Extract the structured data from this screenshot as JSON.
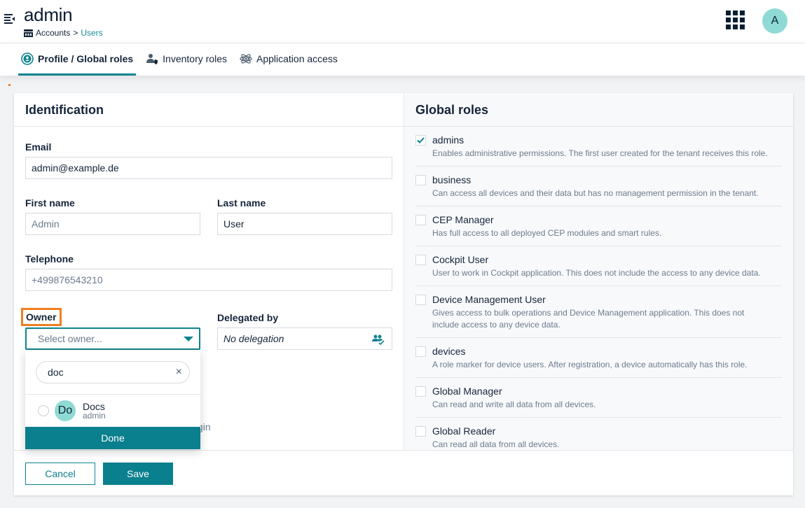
{
  "header": {
    "title": "admin",
    "breadcrumb": {
      "root": "Accounts",
      "separator": ">",
      "current": "Users"
    },
    "avatar_initial": "A",
    "icons": {
      "nav_toggle": "menu-collapse-icon",
      "breadcrumb": "accounts-icon",
      "apps": "app-grid-icon"
    }
  },
  "tabs": [
    {
      "label": "Profile / Global roles",
      "icon": "user-circle-icon",
      "active": true
    },
    {
      "label": "Inventory roles",
      "icon": "user-shield-icon",
      "active": false
    },
    {
      "label": "Application access",
      "icon": "atom-icon",
      "active": false
    }
  ],
  "identification": {
    "heading": "Identification",
    "email": {
      "label": "Email",
      "value": "admin@example.de"
    },
    "first_name": {
      "label": "First name",
      "placeholder": "Admin"
    },
    "last_name": {
      "label": "Last name",
      "value": "User"
    },
    "telephone": {
      "label": "Telephone",
      "placeholder": "+499876543210"
    },
    "owner": {
      "label": "Owner",
      "placeholder": "Select owner..."
    },
    "delegated_by": {
      "label": "Delegated by",
      "value": "No delegation"
    },
    "partially_hidden_text": "gin"
  },
  "owner_dropdown": {
    "search_value": "doc",
    "clear_icon": "×",
    "items": [
      {
        "initials": "Do",
        "name": "Docs",
        "sub": "admin",
        "selected": false
      }
    ],
    "done_label": "Done"
  },
  "global_roles": {
    "heading": "Global roles",
    "roles": [
      {
        "name": "admins",
        "description": "Enables administrative permissions. The first user created for the tenant receives this role.",
        "checked": true
      },
      {
        "name": "business",
        "description": "Can access all devices and their data but has no management permission in the tenant.",
        "checked": false
      },
      {
        "name": "CEP Manager",
        "description": "Has full access to all deployed CEP modules and smart rules.",
        "checked": false
      },
      {
        "name": "Cockpit User",
        "description": "User to work in Cockpit application. This does not include the access to any device data.",
        "checked": false
      },
      {
        "name": "Device Management User",
        "description": "Gives access to bulk operations and Device Management application. This does not include access to any device data.",
        "checked": false
      },
      {
        "name": "devices",
        "description": "A role marker for device users. After registration, a device automatically has this role.",
        "checked": false
      },
      {
        "name": "Global Manager",
        "description": "Can read and write all data from all devices.",
        "checked": false
      },
      {
        "name": "Global Reader",
        "description": "Can read all data from all devices.",
        "checked": false
      }
    ]
  },
  "footer": {
    "cancel_label": "Cancel",
    "save_label": "Save"
  },
  "colors": {
    "primary": "#0a7f8d",
    "highlight": "#f07d22",
    "avatar": "#8fdad5"
  }
}
